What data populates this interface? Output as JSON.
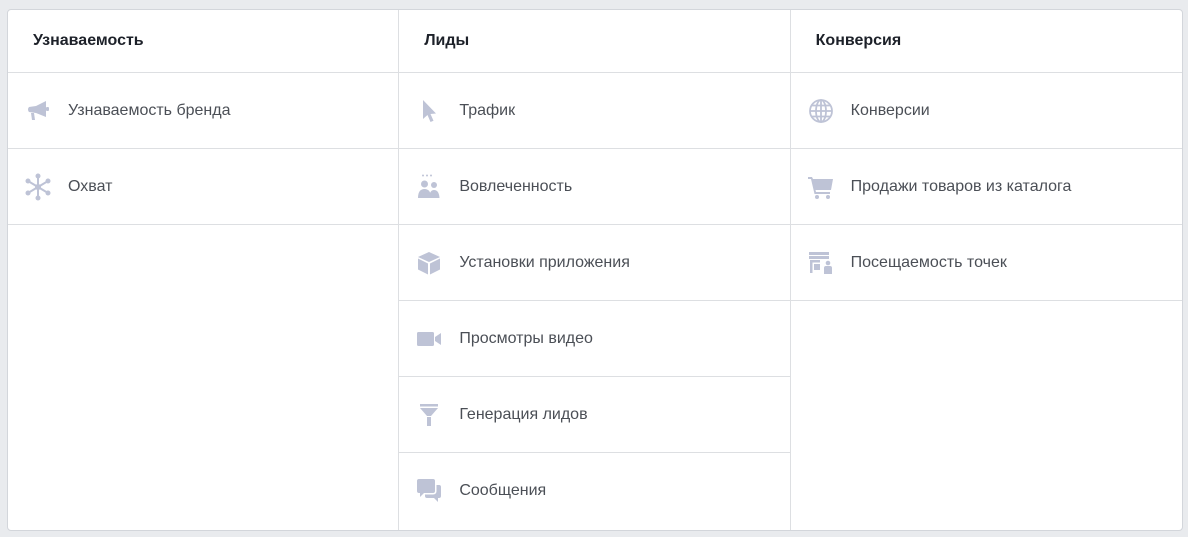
{
  "columns": [
    {
      "header": "Узнаваемость",
      "items": [
        {
          "label": "Узнаваемость бренда",
          "icon": "megaphone-icon"
        },
        {
          "label": "Охват",
          "icon": "asterisk-nodes-icon"
        }
      ]
    },
    {
      "header": "Лиды",
      "items": [
        {
          "label": "Трафик",
          "icon": "cursor-icon"
        },
        {
          "label": "Вовлеченность",
          "icon": "people-icon"
        },
        {
          "label": "Установки приложения",
          "icon": "box-icon"
        },
        {
          "label": "Просмотры видео",
          "icon": "video-camera-icon"
        },
        {
          "label": "Генерация лидов",
          "icon": "funnel-icon"
        },
        {
          "label": "Сообщения",
          "icon": "chat-bubbles-icon"
        }
      ]
    },
    {
      "header": "Конверсия",
      "items": [
        {
          "label": "Конверсии",
          "icon": "globe-icon"
        },
        {
          "label": "Продажи товаров из каталога",
          "icon": "shopping-cart-icon"
        },
        {
          "label": "Посещаемость точек",
          "icon": "store-icon"
        }
      ]
    }
  ],
  "colors": {
    "icon": "#bec3d6",
    "border": "#dddfe2",
    "label": "#4b4f56",
    "header": "#1d2129",
    "background": "#e9ebee"
  }
}
